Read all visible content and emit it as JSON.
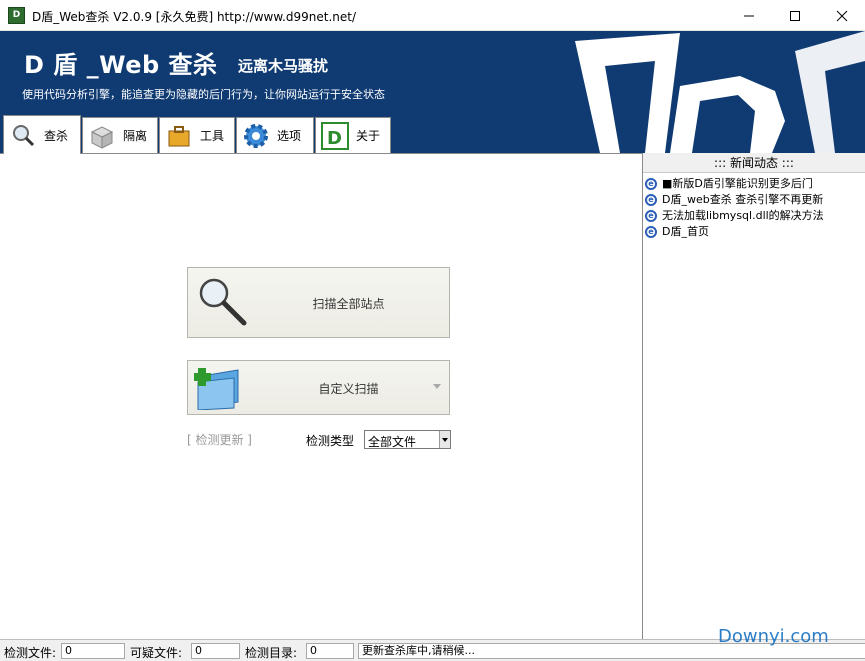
{
  "window": {
    "title": "D盾_Web查杀 V2.0.9 [永久免费] http://www.d99net.net/",
    "icon_text": "D",
    "controls": [
      "minimize",
      "maximize",
      "close"
    ]
  },
  "banner": {
    "title": "D 盾 _Web 查杀",
    "slogan": "远离木马骚扰",
    "description": "使用代码分析引擎，能追查更为隐藏的后门行为，让你网站运行于安全状态",
    "logo_text": "D"
  },
  "tabs": [
    {
      "label": "查杀",
      "icon": "magnifier-icon",
      "active": true
    },
    {
      "label": "隔离",
      "icon": "box-icon",
      "active": false
    },
    {
      "label": "工具",
      "icon": "toolbox-icon",
      "active": false
    },
    {
      "label": "选项",
      "icon": "gear-icon",
      "active": false
    },
    {
      "label": "关于",
      "icon": "d-logo-icon",
      "active": false
    }
  ],
  "main": {
    "scan_all_label": "扫描全部站点",
    "custom_scan_label": "自定义扫描",
    "update_link": "[ 检测更新 ]",
    "type_label": "检测类型",
    "type_value": "全部文件"
  },
  "news": {
    "header": "::: 新闻动态 :::",
    "items": [
      "■新版D盾引擎能识别更多后门",
      "D盾_web查杀 查杀引擎不再更新",
      "无法加载libmysql.dll的解决方法",
      "D盾_首页"
    ]
  },
  "statusbar": {
    "files_label": "检测文件:",
    "files_value": "0",
    "suspicious_label": "可疑文件:",
    "suspicious_value": "0",
    "dirs_label": "检测目录:",
    "dirs_value": "0",
    "message": "更新查杀库中,请稍候..."
  },
  "watermark": "Downyi.com",
  "colors": {
    "banner_bg": "#0f3a72",
    "accent_green": "#2e8b2e",
    "link_gray": "#999999"
  }
}
